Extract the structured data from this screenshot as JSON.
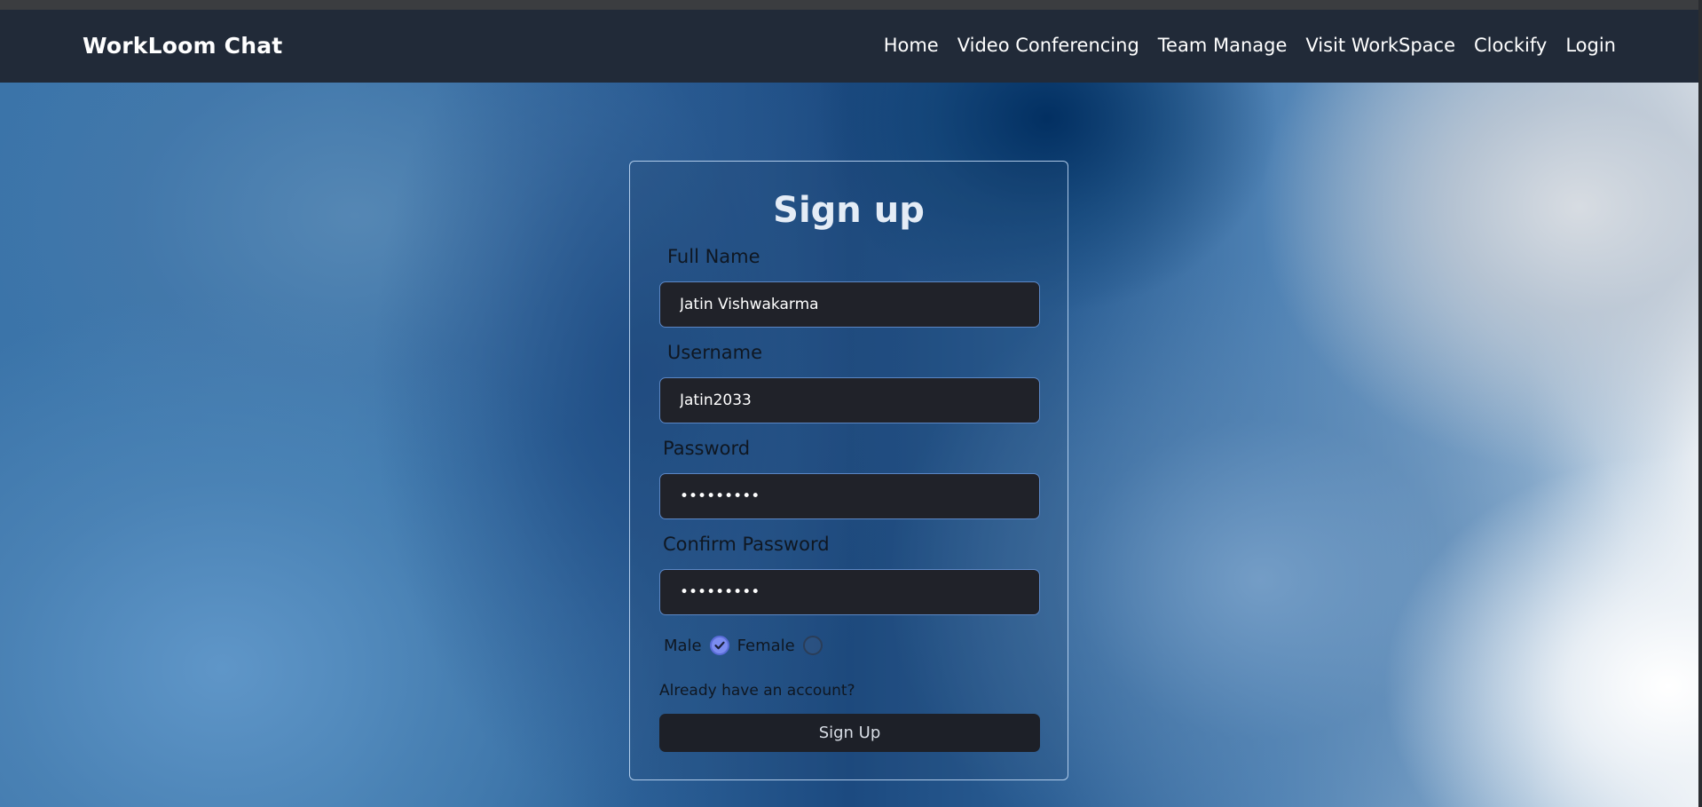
{
  "navbar": {
    "brand": "WorkLoom Chat",
    "links": [
      "Home",
      "Video Conferencing",
      "Team Manage",
      "Visit WorkSpace",
      "Clockify",
      "Login"
    ]
  },
  "form": {
    "title": "Sign up",
    "full_name": {
      "label": "Full Name",
      "value": "Jatin Vishwakarma"
    },
    "username": {
      "label": "Username",
      "value": "Jatin2033"
    },
    "password": {
      "label": "Password",
      "value": "•••••••••"
    },
    "confirm_password": {
      "label": "Confirm Password",
      "value": "•••••••••"
    },
    "gender": {
      "male_label": "Male",
      "female_label": "Female",
      "selected": "Male"
    },
    "already_text": "Already have an account?",
    "submit_label": "Sign Up"
  },
  "colors": {
    "navbar_bg": "#212a38",
    "input_bg": "#202229",
    "button_bg": "#1d2028",
    "radio_checked": "#7b8cf0"
  }
}
